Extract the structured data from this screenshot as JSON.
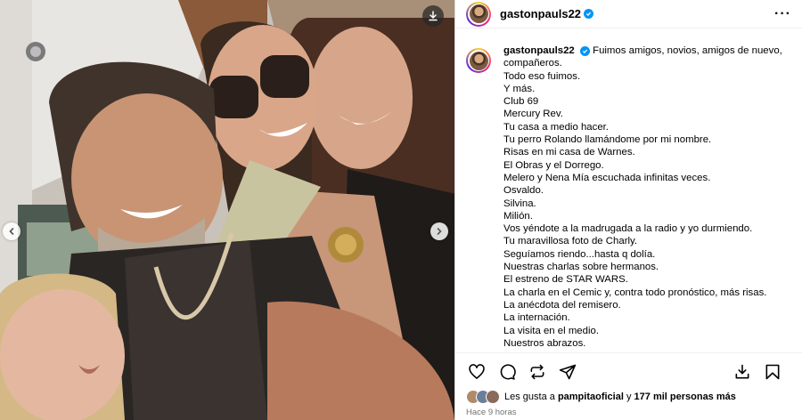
{
  "post": {
    "username": "gastonpauls22",
    "caption_lines": [
      "Fuimos amigos, novios, amigos de nuevo,",
      "compañeros.",
      "Todo eso fuimos.",
      "Y más.",
      "Club 69",
      "Mercury Rev.",
      "Tu casa a medio hacer.",
      "Tu perro Rolando llamándome por mi nombre.",
      "Risas en mi casa de Warnes.",
      "El Obras y el Dorrego.",
      "Melero y Nena Mía escuchada infinitas veces.",
      "Osvaldo.",
      "Silvina.",
      "Milión.",
      "Vos yéndote a la madrugada a la radio y yo durmiendo.",
      "Tu maravillosa foto de Charly.",
      "Seguíamos riendo...hasta q dolía.",
      "Nuestras charlas sobre hermanos.",
      "El estreno de STAR WARS.",
      "La charla en el Cemic y, contra todo pronóstico, más risas.",
      "La anécdota del remisero.",
      "La internación.",
      "La visita en el medio.",
      "Nuestros abrazos."
    ],
    "likes": {
      "prefix": "Les gusta a",
      "user": "pampitaoficial",
      "connector": "y",
      "count": "177 mil personas más"
    },
    "time_ago": "Hace 9 horas"
  },
  "icons": {
    "more": "more-options-icon",
    "download": "download-icon",
    "prev": "chevron-left-icon",
    "next": "chevron-right-icon",
    "like": "heart-icon",
    "comment": "comment-icon",
    "repost": "repost-icon",
    "share": "share-icon",
    "save_collection": "save-to-collection-icon",
    "save": "bookmark-icon"
  },
  "colors": {
    "verified": "#0095f6",
    "muted_text": "#737373",
    "divider": "#efefef"
  }
}
